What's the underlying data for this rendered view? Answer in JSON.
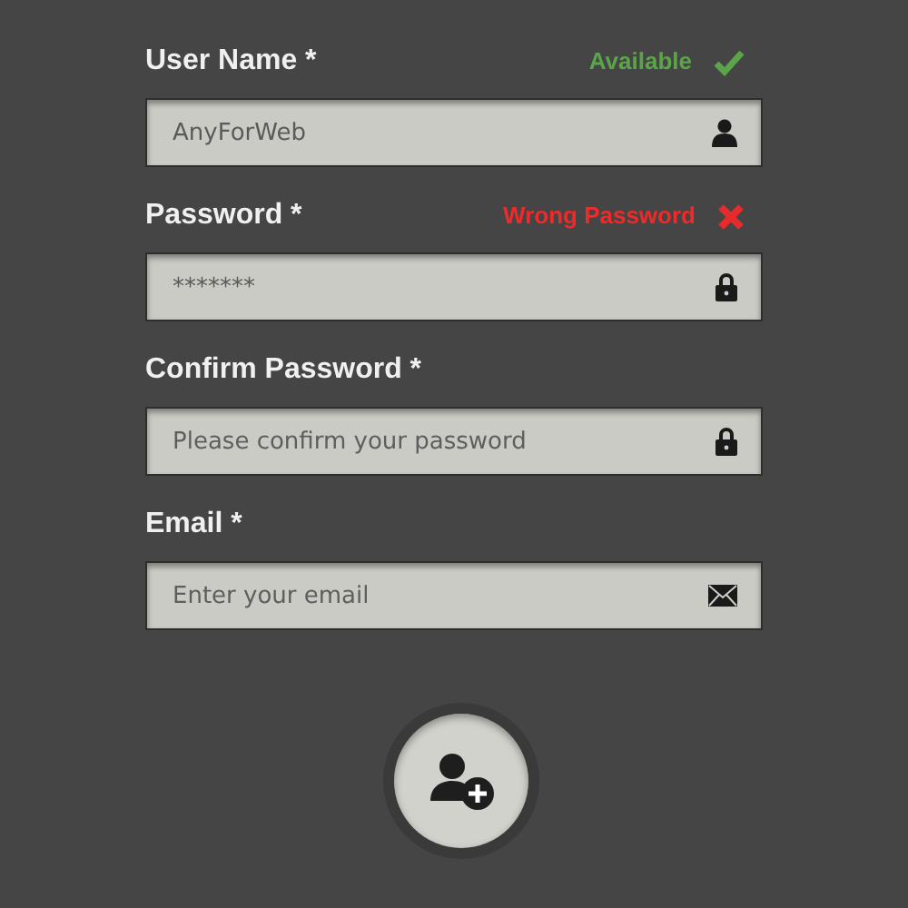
{
  "fields": [
    {
      "label": "User Name *",
      "status": {
        "kind": "ok",
        "text": "Available"
      },
      "value": "AnyForWeb",
      "kind": "username"
    },
    {
      "label": "Password *",
      "status": {
        "kind": "error",
        "text": "Wrong Password"
      },
      "value": "*******",
      "kind": "password"
    },
    {
      "label": "Confirm Password *",
      "placeholder": "Please confirm your password",
      "kind": "password"
    },
    {
      "label": "Email *",
      "placeholder": "Enter your email",
      "kind": "email"
    }
  ]
}
